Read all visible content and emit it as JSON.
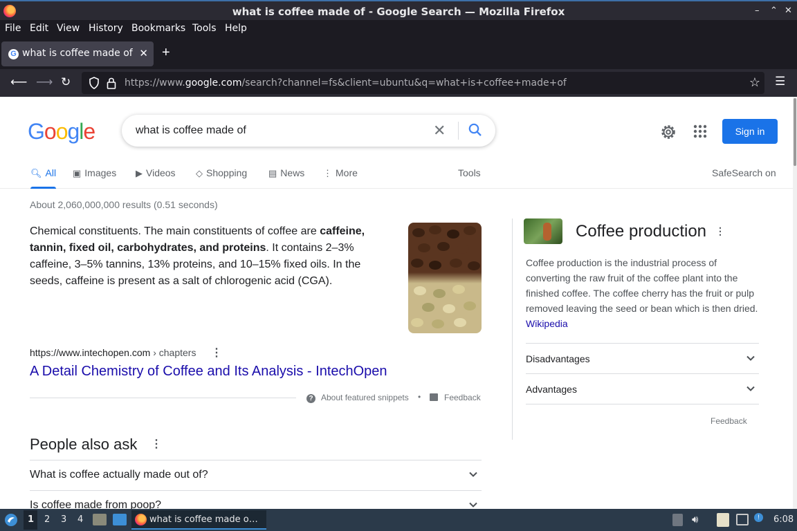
{
  "window": {
    "title": "what is coffee made of - Google Search — Mozilla Firefox",
    "controls": [
      "–",
      "⌃",
      "✕"
    ]
  },
  "menubar": [
    "File",
    "Edit",
    "View",
    "History",
    "Bookmarks",
    "Tools",
    "Help"
  ],
  "tab": {
    "title": "what is coffee made of - Google Search",
    "favicon": "G"
  },
  "navbar": {
    "url_prefix": "https://www.",
    "url_domain": "google.com",
    "url_path": "/search?channel=fs&client=ubuntu&q=what+is+coffee+made+of"
  },
  "google": {
    "logo_letters": [
      "G",
      "o",
      "o",
      "g",
      "l",
      "e"
    ],
    "logo_colors": [
      "#4285f4",
      "#ea4335",
      "#fbbc05",
      "#4285f4",
      "#34a853",
      "#ea4335"
    ],
    "query": "what is coffee made of",
    "signin": "Sign in",
    "tabs": [
      "All",
      "Images",
      "Videos",
      "Shopping",
      "News",
      "More"
    ],
    "tools": "Tools",
    "safesearch": "SafeSearch on",
    "stats": "About 2,060,000,000 results (0.51 seconds)"
  },
  "snippet": {
    "text_before": "Chemical constituents. The main constituents of coffee are ",
    "text_bold": "caffeine, tannin, fixed oil, carbohydrates, and proteins",
    "text_after": ". It contains 2–3% caffeine, 3–5% tannins, 13% proteins, and 10–15% fixed oils. In the seeds, caffeine is present as a salt of chlorogenic acid (CGA).",
    "cite_url": "https://www.intechopen.com",
    "cite_crumb": " › chapters",
    "result_title": "A Detail Chemistry of Coffee and Its Analysis - IntechOpen",
    "about_snippets": "About featured snippets",
    "bullet": "•",
    "feedback": "Feedback"
  },
  "people_also_ask": {
    "heading": "People also ask",
    "questions": [
      "What is coffee actually made out of?",
      "Is coffee made from poop?"
    ]
  },
  "knowledge_panel": {
    "title": "Coffee production",
    "description": "Coffee production is the industrial process of converting the raw fruit of the coffee plant into the finished coffee. The coffee cherry has the fruit or pulp removed leaving the seed or bean which is then dried.",
    "source": "Wikipedia",
    "rows": [
      "Disadvantages",
      "Advantages"
    ],
    "feedback": "Feedback"
  },
  "taskbar": {
    "workspaces": [
      "1",
      "2",
      "3",
      "4"
    ],
    "app_title": "what is coffee made o…",
    "clock": "6:08"
  },
  "colors": {
    "accent": "#1a73e8",
    "link": "#1a0dab"
  }
}
